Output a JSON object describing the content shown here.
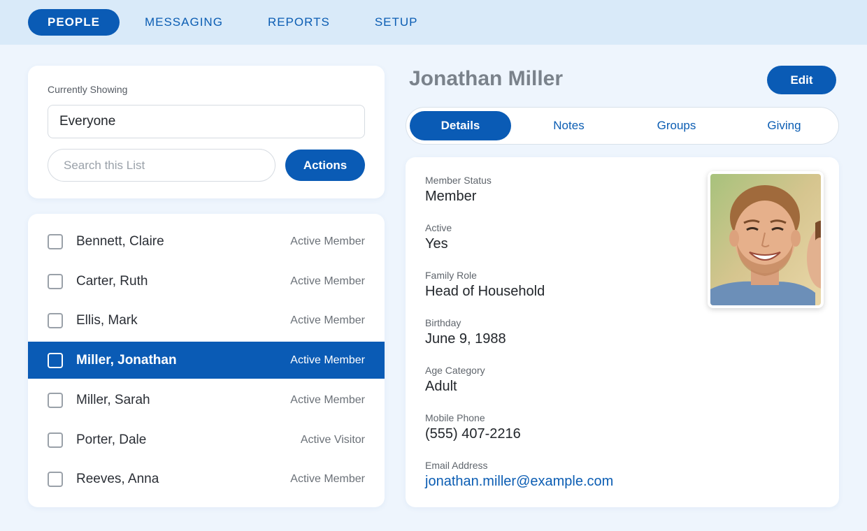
{
  "nav": {
    "items": [
      {
        "label": "PEOPLE",
        "active": true
      },
      {
        "label": "MESSAGING",
        "active": false
      },
      {
        "label": "REPORTS",
        "active": false
      },
      {
        "label": "SETUP",
        "active": false
      }
    ]
  },
  "filter": {
    "label": "Currently Showing",
    "selected": "Everyone",
    "search_placeholder": "Search this List",
    "actions_label": "Actions"
  },
  "people_list": [
    {
      "name": "Bennett, Claire",
      "status": "Active Member",
      "selected": false
    },
    {
      "name": "Carter, Ruth",
      "status": "Active Member",
      "selected": false
    },
    {
      "name": "Ellis, Mark",
      "status": "Active Member",
      "selected": false
    },
    {
      "name": "Miller, Jonathan",
      "status": "Active Member",
      "selected": true
    },
    {
      "name": "Miller, Sarah",
      "status": "Active Member",
      "selected": false
    },
    {
      "name": "Porter, Dale",
      "status": "Active Visitor",
      "selected": false
    },
    {
      "name": "Reeves, Anna",
      "status": "Active Member",
      "selected": false
    }
  ],
  "person": {
    "name": "Jonathan Miller",
    "edit_label": "Edit",
    "tabs": [
      {
        "label": "Details",
        "active": true
      },
      {
        "label": "Notes",
        "active": false
      },
      {
        "label": "Groups",
        "active": false
      },
      {
        "label": "Giving",
        "active": false
      }
    ],
    "fields": [
      {
        "label": "Member Status",
        "value": "Member"
      },
      {
        "label": "Active",
        "value": "Yes"
      },
      {
        "label": "Family Role",
        "value": "Head of Household"
      },
      {
        "label": "Birthday",
        "value": "June 9, 1988"
      },
      {
        "label": "Age Category",
        "value": "Adult"
      },
      {
        "label": "Mobile Phone",
        "value": "(555) 407-2216"
      },
      {
        "label": "Email Address",
        "value": "jonathan.miller@example.com",
        "link": true
      }
    ]
  },
  "colors": {
    "accent": "#0a5bb5",
    "nav_bg": "#d9eaf9",
    "page_bg": "#eef5fd",
    "link": "#0b5db3"
  }
}
